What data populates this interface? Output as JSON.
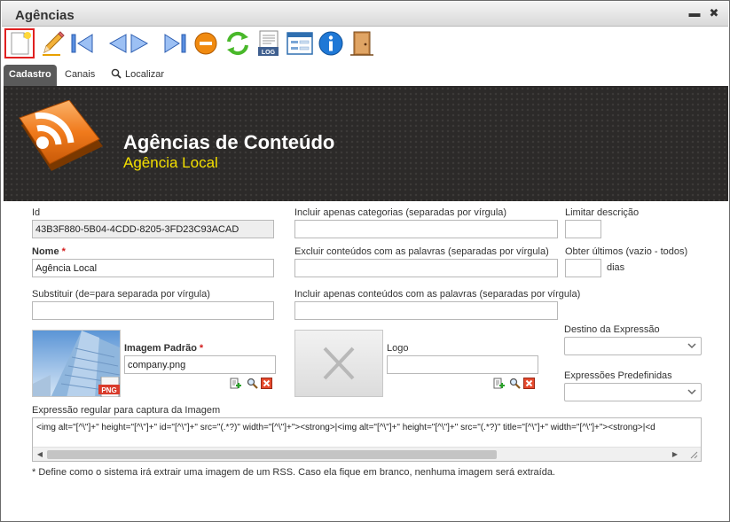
{
  "window": {
    "title": "Agências",
    "minimize_label": "▬",
    "close_label": "✖"
  },
  "toolbar": {
    "tools": [
      "new-icon",
      "edit-pencil-icon",
      "first-record-icon",
      "previous-next-icon",
      "last-record-icon",
      "delete-icon",
      "refresh-icon",
      "log-icon",
      "form-view-icon",
      "info-icon",
      "exit-door-icon"
    ],
    "log_text": "LOG"
  },
  "tabs": {
    "cadastro": "Cadastro",
    "canais": "Canais",
    "localizar": "Localizar"
  },
  "banner": {
    "title": "Agências de Conteúdo",
    "subtitle": "Agência Local"
  },
  "form": {
    "id_label": "Id",
    "id_value": "43B3F880-5B04-4CDD-8205-3FD23C93ACAD",
    "nome_label": "Nome",
    "nome_value": "Agência Local",
    "substituir_label": "Substituir (de=para separada por vírgula)",
    "substituir_value": "",
    "incluir_cat_label": "Incluir apenas categorias (separadas por vírgula)",
    "incluir_cat_value": "",
    "excluir_label": "Excluir conteúdos com as palavras (separadas por vírgula)",
    "excluir_value": "",
    "incluir_cont_label": "Incluir apenas conteúdos com as palavras (separadas por vírgula)",
    "incluir_cont_value": "",
    "limitar_label": "Limitar descrição",
    "limitar_value": "",
    "obter_label": "Obter últimos (vazio - todos)",
    "obter_value": "",
    "dias_label": "dias",
    "imagem_label": "Imagem Padrão",
    "imagem_value": "company.png",
    "png_badge": "PNG",
    "logo_label": "Logo",
    "logo_value": "",
    "destino_label": "Destino da Expressão",
    "destino_value": "",
    "expressoes_label": "Expressões Predefinidas",
    "expressoes_value": "",
    "regex_label": "Expressão regular para captura da Imagem",
    "regex_value": "<img alt=\"[^\\\"]+\" height=\"[^\\\"]+\" id=\"[^\\\"]+\" src=\"(.*?)\" width=\"[^\\\"]+\"><strong>|<img alt=\"[^\\\"]+\" height=\"[^\\\"]+\" src=\"(.*?)\" title=\"[^\\\"]+\" width=\"[^\\\"]+\"><strong>|<d",
    "note": "* Define como o sistema irá extrair uma imagem de um RSS.  Caso ela fique em branco, nenhuma imagem será extraída."
  },
  "colors": {
    "banner_bg": "#2c2a29",
    "subtitle": "#f5e000",
    "required": "#d21b1b",
    "tab_active": "#5a5a5a",
    "rss_orange": "#f07a1c"
  }
}
